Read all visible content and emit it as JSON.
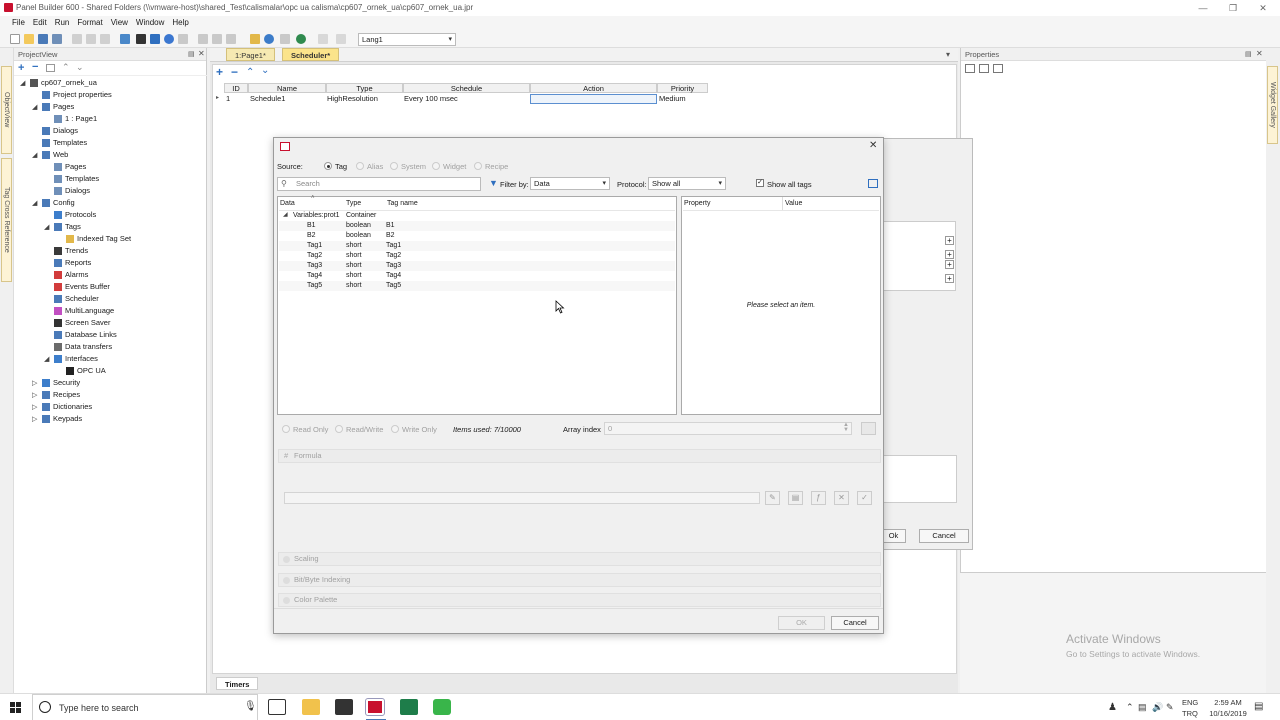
{
  "window": {
    "title": "Panel Builder 600 - Shared Folders (\\\\vmware-host)\\shared_Test\\calismalar\\opc ua calisma\\cp607_ornek_ua\\cp607_ornek_ua.jpr"
  },
  "menu": [
    "File",
    "Edit",
    "Run",
    "Format",
    "View",
    "Window",
    "Help"
  ],
  "toolbar": {
    "language": "Lang1"
  },
  "left_rail": {
    "tabs": [
      "ObjectView",
      "Tag Cross Reference"
    ]
  },
  "right_rail": {
    "tabs": [
      "Widget Gallery"
    ]
  },
  "project_view": {
    "title": "ProjectView",
    "items": [
      {
        "label": "cp607_ornek_ua",
        "depth": 0
      },
      {
        "label": "Project properties",
        "depth": 1
      },
      {
        "label": "Pages",
        "depth": 1
      },
      {
        "label": "1 : Page1",
        "depth": 2
      },
      {
        "label": "Dialogs",
        "depth": 1
      },
      {
        "label": "Templates",
        "depth": 1
      },
      {
        "label": "Web",
        "depth": 1
      },
      {
        "label": "Pages",
        "depth": 2
      },
      {
        "label": "Templates",
        "depth": 2
      },
      {
        "label": "Dialogs",
        "depth": 2
      },
      {
        "label": "Config",
        "depth": 1
      },
      {
        "label": "Protocols",
        "depth": 2
      },
      {
        "label": "Tags",
        "depth": 2
      },
      {
        "label": "Indexed Tag Set",
        "depth": 3
      },
      {
        "label": "Trends",
        "depth": 2
      },
      {
        "label": "Reports",
        "depth": 2
      },
      {
        "label": "Alarms",
        "depth": 2
      },
      {
        "label": "Events Buffer",
        "depth": 2
      },
      {
        "label": "Scheduler",
        "depth": 2
      },
      {
        "label": "MultiLanguage",
        "depth": 2
      },
      {
        "label": "Screen Saver",
        "depth": 2
      },
      {
        "label": "Database Links",
        "depth": 2
      },
      {
        "label": "Data transfers",
        "depth": 2
      },
      {
        "label": "Interfaces",
        "depth": 2
      },
      {
        "label": "OPC UA",
        "depth": 3
      },
      {
        "label": "Security",
        "depth": 1
      },
      {
        "label": "Recipes",
        "depth": 1
      },
      {
        "label": "Dictionaries",
        "depth": 1
      },
      {
        "label": "Keypads",
        "depth": 1
      }
    ]
  },
  "doc_tabs": [
    "1:Page1*",
    "Scheduler*"
  ],
  "scheduler": {
    "columns": [
      "ID",
      "Name",
      "Type",
      "Schedule",
      "Action",
      "Priority"
    ],
    "rows": [
      {
        "id": "1",
        "name": "Schedule1",
        "type": "HighResolution",
        "schedule": "Every 100 msec",
        "action": "",
        "priority": "Medium"
      }
    ]
  },
  "bottom_tab": "Timers",
  "properties_panel": {
    "title": "Properties"
  },
  "bg_dialog": {
    "ok_label": "Ok",
    "cancel_label": "Cancel"
  },
  "tag_dialog": {
    "source_label": "Source:",
    "sources": [
      {
        "label": "Tag",
        "selected": true,
        "enabled": true
      },
      {
        "label": "Alias",
        "selected": false,
        "enabled": false
      },
      {
        "label": "System",
        "selected": false,
        "enabled": false
      },
      {
        "label": "Widget",
        "selected": false,
        "enabled": false
      },
      {
        "label": "Recipe",
        "selected": false,
        "enabled": false
      }
    ],
    "search_placeholder": "Search",
    "filter_label": "Filter by:",
    "filter_value": "Data",
    "protocol_label": "Protocol:",
    "protocol_value": "Show all",
    "show_all_tags_label": "Show all tags",
    "show_all_tags_checked": true,
    "tag_columns": [
      "Data",
      "Type",
      "Tag name"
    ],
    "group": {
      "data": "Variables:prot1",
      "type": "Container"
    },
    "tags": [
      {
        "data": "B1",
        "type": "boolean",
        "name": "B1"
      },
      {
        "data": "B2",
        "type": "boolean",
        "name": "B2"
      },
      {
        "data": "Tag1",
        "type": "short",
        "name": "Tag1"
      },
      {
        "data": "Tag2",
        "type": "short",
        "name": "Tag2"
      },
      {
        "data": "Tag3",
        "type": "short",
        "name": "Tag3"
      },
      {
        "data": "Tag4",
        "type": "short",
        "name": "Tag4"
      },
      {
        "data": "Tag5",
        "type": "short",
        "name": "Tag5"
      }
    ],
    "prop_columns": [
      "Property",
      "Value"
    ],
    "prop_empty": "Please select an item.",
    "access": [
      "Read Only",
      "Read/Write",
      "Write Only"
    ],
    "items_used": "Items used:  7/10000",
    "array_index_label": "Array index",
    "array_index_value": "0",
    "sections": [
      "Formula",
      "Scaling",
      "Bit/Byte Indexing",
      "Color Palette"
    ],
    "ok_label": "OK",
    "cancel_label": "Cancel"
  },
  "watermark": {
    "line1": "Activate Windows",
    "line2": "Go to Settings to activate Windows."
  },
  "taskbar": {
    "search_placeholder": "Type here to search",
    "lang_line1": "ENG",
    "lang_line2": "TRQ",
    "time": "2:59 AM",
    "date": "10/16/2019"
  }
}
